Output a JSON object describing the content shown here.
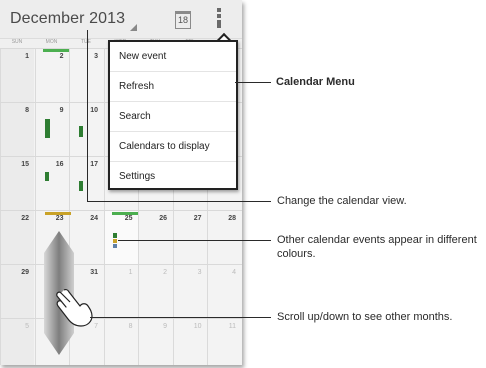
{
  "calendar": {
    "title": "December 2013",
    "today_icon_label": "18",
    "menu_icon": "overflow-menu-icon",
    "weekdays": [
      "SUN",
      "MON",
      "TUE",
      "WED",
      "THU",
      "FRI",
      "SAT"
    ],
    "weeks": [
      [
        {
          "d": "1"
        },
        {
          "d": "2"
        },
        {
          "d": "3"
        },
        {
          "d": ""
        },
        {
          "d": ""
        },
        {
          "d": ""
        },
        {
          "d": ""
        }
      ],
      [
        {
          "d": "8"
        },
        {
          "d": "9"
        },
        {
          "d": "10"
        },
        {
          "d": ""
        },
        {
          "d": ""
        },
        {
          "d": ""
        },
        {
          "d": ""
        }
      ],
      [
        {
          "d": "15"
        },
        {
          "d": "16"
        },
        {
          "d": "17"
        },
        {
          "d": ""
        },
        {
          "d": ""
        },
        {
          "d": ""
        },
        {
          "d": ""
        }
      ],
      [
        {
          "d": "22"
        },
        {
          "d": "23"
        },
        {
          "d": "24"
        },
        {
          "d": "25"
        },
        {
          "d": "26"
        },
        {
          "d": "27"
        },
        {
          "d": "28"
        }
      ],
      [
        {
          "d": "29"
        },
        {
          "d": "30"
        },
        {
          "d": "31"
        },
        {
          "d": "1",
          "muted": true
        },
        {
          "d": "2",
          "muted": true
        },
        {
          "d": "3",
          "muted": true
        },
        {
          "d": "4",
          "muted": true
        }
      ],
      [
        {
          "d": "5",
          "muted": true
        },
        {
          "d": "6",
          "muted": true
        },
        {
          "d": "7",
          "muted": true
        },
        {
          "d": "8",
          "muted": true
        },
        {
          "d": "9",
          "muted": true
        },
        {
          "d": "10",
          "muted": true
        },
        {
          "d": "11",
          "muted": true
        }
      ]
    ]
  },
  "menu": {
    "items": [
      "New event",
      "Refresh",
      "Search",
      "Calendars to display",
      "Settings"
    ]
  },
  "callouts": {
    "calendar_menu": "Calendar Menu",
    "change_view": "Change the calendar view.",
    "other_events": "Other calendar events appear in different colours.",
    "scroll": "Scroll up/down to see other months."
  },
  "colors": {
    "event_green": "#2e7d32",
    "event_gold": "#c9a227",
    "event_blue": "#5f7fa8",
    "event_brown": "#8a6d3b",
    "event_light_green": "#4caf50"
  },
  "icons": [
    "calendar-today-icon",
    "overflow-menu-icon",
    "scroll-handle-icon",
    "hand-swipe-icon"
  ]
}
